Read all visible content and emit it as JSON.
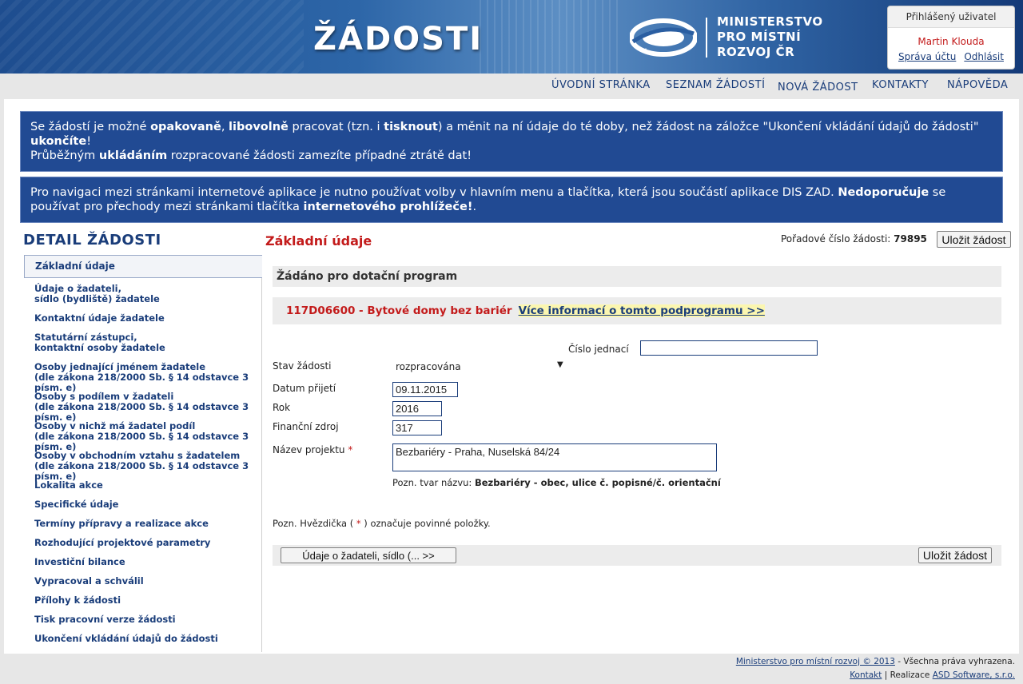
{
  "app_title": "ŽÁDOSTI",
  "ministry": {
    "line1": "MINISTERSTVO",
    "line2": "PRO MÍSTNÍ",
    "line3": "ROZVOJ ČR"
  },
  "user": {
    "header": "Přihlášený uživatel",
    "name": "Martin Klouda",
    "manage_label": "Správa účtu",
    "logout_label": "Odhlásit"
  },
  "nav": [
    "ÚVODNÍ STRÁNKA",
    "SEZNAM ŽÁDOSTÍ",
    "NOVÁ ŽÁDOST",
    "KONTAKTY",
    "NÁPOVĚDA"
  ],
  "notice1": {
    "p1": "Se žádostí je možné ",
    "b1": "opakovaně",
    "p2": ", ",
    "b2": "libovolně",
    "p3": " pracovat (tzn. i ",
    "b3": "tisknout",
    "p4": ") a měnit na ní údaje do té doby, než žádost na záložce \"Ukončení vkládání údajů do žádosti\" ",
    "b4": "ukončíte",
    "p5": "!",
    "p6": "Průběžným ",
    "b5": "ukládáním",
    "p7": " rozpracované žádosti zamezíte případné ztrátě dat!"
  },
  "notice2": {
    "p1": "Pro navigaci mezi stránkami internetové aplikace je nutno používat volby v hlavním menu a tlačítka, která jsou součástí aplikace DIS ZAD. ",
    "b1": "Nedoporučuje",
    "p2": " se používat pro přechody mezi stránkami tlačítka ",
    "b2": "internetového prohlížeče!",
    "p3": "."
  },
  "sidebar": {
    "title": "DETAIL ŽÁDOSTI",
    "items": [
      {
        "l1": "Základní údaje",
        "l2": ""
      },
      {
        "l1": "Údaje o žadateli,",
        "l2": "sídlo (bydliště) žadatele"
      },
      {
        "l1": "Kontaktní údaje žadatele",
        "l2": ""
      },
      {
        "l1": "Statutární zástupci,",
        "l2": "kontaktní osoby žadatele"
      },
      {
        "l1": "Osoby jednající jménem žadatele",
        "l2": "(dle zákona 218/2000 Sb. § 14 odstavce 3 písm. e)"
      },
      {
        "l1": "Osoby s podílem v žadateli",
        "l2": "(dle zákona 218/2000 Sb. § 14 odstavce 3 písm. e)"
      },
      {
        "l1": "Osoby v nichž má žadatel podíl",
        "l2": "(dle zákona 218/2000 Sb. § 14 odstavce 3 písm. e)"
      },
      {
        "l1": "Osoby v obchodním vztahu s žadatelem",
        "l2": "(dle zákona 218/2000 Sb. § 14 odstavce 3 písm. e)"
      },
      {
        "l1": "Lokalita akce",
        "l2": ""
      },
      {
        "l1": "Specifické údaje",
        "l2": ""
      },
      {
        "l1": "Termíny přípravy a realizace akce",
        "l2": ""
      },
      {
        "l1": "Rozhodující projektové parametry",
        "l2": ""
      },
      {
        "l1": "Investiční bilance",
        "l2": ""
      },
      {
        "l1": "Vypracoval a schválil",
        "l2": ""
      },
      {
        "l1": "Přílohy k žádosti",
        "l2": ""
      },
      {
        "l1": "Tisk pracovní verze žádosti",
        "l2": ""
      },
      {
        "l1": "Ukončení vkládání údajů do žádosti",
        "l2": ""
      }
    ]
  },
  "main": {
    "section_title": "Základní údaje",
    "poradove_label": "Pořadové číslo žádosti:",
    "poradove_value": "79895",
    "save_label": "Uložit žádost",
    "panel_title": "Žádáno pro dotační program",
    "program_code": "117D06600 - Bytové domy bez bariér",
    "program_link": "Více informací o tomto podprogramu >>",
    "cislo_jednaci_label": "Číslo jednací",
    "cislo_jednaci_value": "",
    "stav_label": "Stav žádosti",
    "stav_value": "rozpracována",
    "datum_label": "Datum přijetí",
    "datum_value": "09.11.2015",
    "rok_label": "Rok",
    "rok_value": "2016",
    "zdroj_label": "Finanční zdroj",
    "zdroj_value": "317",
    "nazev_label": "Název projektu",
    "required_mark": "*",
    "nazev_value": "Bezbariéry - Praha, Nuselská 84/24",
    "pozn_prefix": "Pozn. tvar názvu: ",
    "pozn_bold": "Bezbariéry - obec, ulice č. popisné/č. orientační",
    "hvezdicka_p1": "Pozn. Hvězdička ( ",
    "hvezdicka_p2": " ) označuje povinné položky.",
    "next_label": "Údaje o žadateli, sídlo (...   >>",
    "save_label2": "Uložit žádost"
  },
  "footer": {
    "ministry_link": "Ministerstvo pro místní rozvoj © 2013",
    "rights": " - Všechna práva vyhrazena.",
    "kontakt": "Kontakt",
    "realizace": " | Realizace ",
    "asd": "ASD Software, s.r.o."
  },
  "colors": {
    "brand_blue": "#214a93",
    "link_blue": "#1a3d7a",
    "accent_red": "#c31b1b",
    "highlight_yellow": "#fbf6b0"
  }
}
